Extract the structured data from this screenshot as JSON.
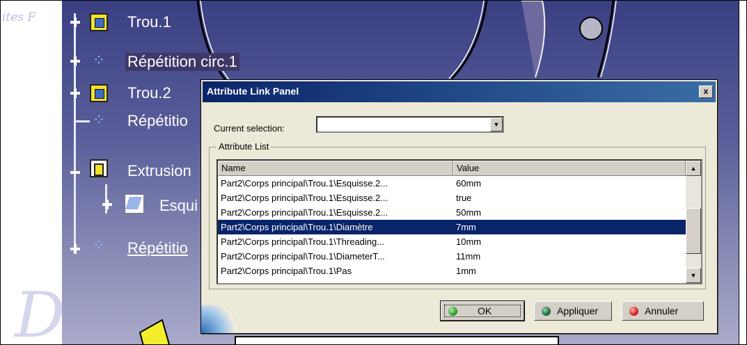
{
  "watermark": {
    "text": "ites F",
    "letter": "D"
  },
  "tree": {
    "items": [
      {
        "label": "Trou.1",
        "icon": "hole-feature-icon"
      },
      {
        "label": "Répétition circ.1",
        "icon": "circular-pattern-icon"
      },
      {
        "label": "Trou.2",
        "icon": "hole-feature-icon"
      },
      {
        "label": "Répétitio",
        "icon": "circular-pattern-icon"
      },
      {
        "label": "Extrusion",
        "icon": "extrusion-icon"
      },
      {
        "label": "Esqui",
        "icon": "sketch-icon"
      },
      {
        "label": "Répétitio",
        "icon": "circular-pattern-icon"
      }
    ]
  },
  "dialog": {
    "title": "Attribute Link Panel",
    "close_label": "x",
    "current_selection_label": "Current selection:",
    "current_selection_value": "",
    "group_label": "Attribute List",
    "columns": [
      "Name",
      "Value"
    ],
    "rows": [
      {
        "name": "Part2\\Corps principal\\Trou.1\\Esquisse.2...",
        "value": "60mm",
        "selected": false
      },
      {
        "name": "Part2\\Corps principal\\Trou.1\\Esquisse.2...",
        "value": "true",
        "selected": false
      },
      {
        "name": "Part2\\Corps principal\\Trou.1\\Esquisse.2...",
        "value": "50mm",
        "selected": false
      },
      {
        "name": "Part2\\Corps principal\\Trou.1\\Diamètre",
        "value": "7mm",
        "selected": true
      },
      {
        "name": "Part2\\Corps principal\\Trou.1\\Threading...",
        "value": "10mm",
        "selected": false
      },
      {
        "name": "Part2\\Corps principal\\Trou.1\\DiameterT...",
        "value": "11mm",
        "selected": false
      },
      {
        "name": "Part2\\Corps principal\\Trou.1\\Pas",
        "value": "1mm",
        "selected": false
      }
    ],
    "buttons": {
      "ok": "OK",
      "apply": "Appliquer",
      "cancel": "Annuler"
    }
  },
  "colors": {
    "ok_dot": "#2e9e2e",
    "apply_dot": "#1f6b3f",
    "cancel_dot": "#d42020",
    "selection": "#0a246a"
  }
}
